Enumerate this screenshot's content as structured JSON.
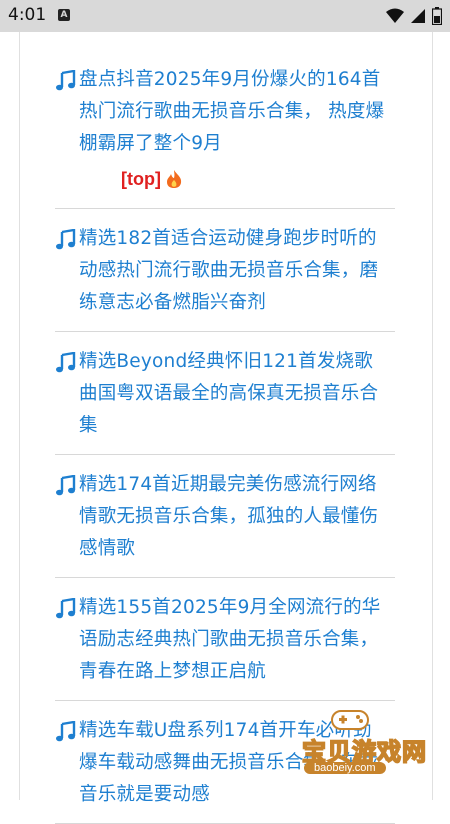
{
  "status_bar": {
    "time": "4:01",
    "notification_glyph": "A"
  },
  "top_tag": "[top]",
  "list": [
    {
      "text": "盘点抖音2025年9月份爆火的164首热门流行歌曲无损音乐合集， 热度爆棚霸屏了整个9月",
      "pinned": true
    },
    {
      "text": "精选182首适合运动健身跑步时听的动感热门流行歌曲无损音乐合集，磨练意志必备燃脂兴奋剂",
      "pinned": false
    },
    {
      "text": "精选Beyond经典怀旧121首发烧歌曲国粤双语最全的高保真无损音乐合集",
      "pinned": false
    },
    {
      "text": "精选174首近期最完美伤感流行网络情歌无损音乐合集，孤独的人最懂伤感情歌",
      "pinned": false
    },
    {
      "text": "精选155首2025年9月全网流行的华语励志经典热门歌曲无损音乐合集，青春在路上梦想正启航",
      "pinned": false
    },
    {
      "text": "精选车载U盘系列174首开车必听劲爆车载动感舞曲无损音乐合集，车载音乐就是要动感",
      "pinned": false
    }
  ],
  "watermark": {
    "text": "宝贝游戏网",
    "url": "baobeiy.com"
  },
  "colors": {
    "link": "#1e7fd0",
    "top": "#e02020"
  }
}
